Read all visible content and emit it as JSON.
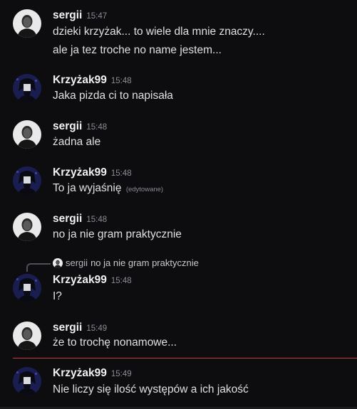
{
  "messages": [
    {
      "user": "sergii",
      "time": "15:47",
      "avatar": "sergii-avatar",
      "lines": [
        "dzieki krzyżak... to wiele dla mnie znaczy....",
        "ale ja tez troche no name jestem..."
      ]
    },
    {
      "user": "Krzyżak99",
      "time": "15:48",
      "avatar": "krzyzak-avatar",
      "lines": [
        "Jaka pizda ci to napisała"
      ]
    },
    {
      "user": "sergii",
      "time": "15:48",
      "avatar": "sergii-avatar",
      "lines": [
        "żadna ale"
      ]
    },
    {
      "user": "Krzyżak99",
      "time": "15:48",
      "avatar": "krzyzak-avatar",
      "lines": [
        "To ja wyjaśnię"
      ],
      "edited": "(edytowane)"
    },
    {
      "user": "sergii",
      "time": "15:48",
      "avatar": "sergii-avatar",
      "lines": [
        "no ja nie gram praktycznie"
      ]
    },
    {
      "user": "Krzyżak99",
      "time": "15:48",
      "avatar": "krzyzak-avatar",
      "reply": {
        "user": "sergii",
        "text": "no ja nie gram praktycznie"
      },
      "lines": [
        "I?"
      ]
    },
    {
      "user": "sergii",
      "time": "15:49",
      "avatar": "sergii-avatar",
      "lines": [
        "że to trochę nonamowe..."
      ]
    },
    {
      "user": "Krzyżak99",
      "time": "15:49",
      "avatar": "krzyzak-avatar",
      "lines": [
        "Nie liczy się ilość występów a ich jakość"
      ]
    }
  ],
  "colors": {
    "background": "#0d0d0f",
    "new_messages_divider": "#c9383a"
  }
}
